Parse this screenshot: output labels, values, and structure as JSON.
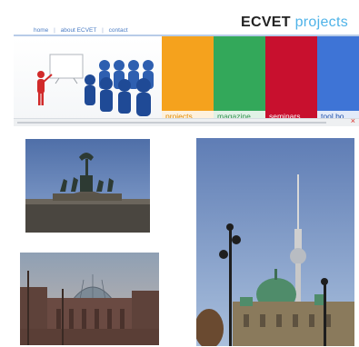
{
  "site": {
    "nav": [
      "home",
      "about ECVET",
      "contact"
    ],
    "nav_separator": "|",
    "brand_part1": "ECVET",
    "brand_part2": "projects",
    "tiles": [
      {
        "label": "projects",
        "color": "#f5a21d"
      },
      {
        "label": "magazine",
        "color": "#33a85a"
      },
      {
        "label": "seminars",
        "color": "#c8102e"
      },
      {
        "label": "tool bo",
        "color": "#3e74d6"
      }
    ],
    "notice_close": "×"
  },
  "photos": [
    {
      "subject": "brandenburg-gate-quadriga"
    },
    {
      "subject": "berlin-tv-tower-cathedral"
    },
    {
      "subject": "reichstag-dome"
    }
  ],
  "colors": {
    "nav_link": "#4a7cc4",
    "brand_accent": "#4fb3e8",
    "sky": "#6a86b8"
  }
}
